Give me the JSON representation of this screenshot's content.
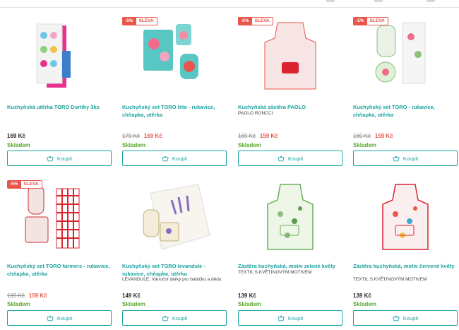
{
  "products": [
    {
      "title": "Kuchyňská utěrka TORO Dortíky 3ks",
      "subtitle": "",
      "badge_pct": "",
      "badge_label": "",
      "price_old": "",
      "price": "169 Kč",
      "stock": "Skladem",
      "buy": "Koupit"
    },
    {
      "title": "Kuchyňský set TORO léto - rukavice, chňapka, utěrka",
      "subtitle": "",
      "badge_pct": "-5%",
      "badge_label": "SLEVA",
      "price_old": "179 Kč",
      "price": "169 Kč",
      "stock": "Skladem",
      "buy": "Koupit"
    },
    {
      "title": "Kuchyňská zástěra PAOLO",
      "subtitle": "PAOLO RONCCI",
      "badge_pct": "-5%",
      "badge_label": "SLEVA",
      "price_old": "169 Kč",
      "price": "159 Kč",
      "stock": "Skladem",
      "buy": "Koupit"
    },
    {
      "title": "Kuchyňský set TORO - rukavice, chňapka, utěrka",
      "subtitle": "",
      "badge_pct": "-5%",
      "badge_label": "SLEVA",
      "price_old": "169 Kč",
      "price": "159 Kč",
      "stock": "Skladem",
      "buy": "Koupit"
    },
    {
      "title": "Kuchyňský set TORO farmers - rukavice, chňapka, utěrka",
      "subtitle": "",
      "badge_pct": "-5%",
      "badge_label": "SLEVA",
      "price_old": "169 Kč",
      "price": "159 Kč",
      "stock": "Skladem",
      "buy": "Koupit"
    },
    {
      "title": "Kuchyňský set TORO levandule - rukavice, chňapka, utěrka",
      "subtitle": "LEVANDULE, Vánoční dárky pro babičku a dědu",
      "badge_pct": "",
      "badge_label": "",
      "price_old": "",
      "price": "149 Kč",
      "stock": "Skladem",
      "buy": "Koupit"
    },
    {
      "title": "Zástěra kuchyňská, motiv zelené květy",
      "subtitle": "TEXTIL S KVĚTINOVÝM MOTIVEM",
      "badge_pct": "",
      "badge_label": "",
      "price_old": "",
      "price": "139 Kč",
      "stock": "Skladem",
      "buy": "Koupit"
    },
    {
      "title": "Zástěra kuchyňská, motiv červené květy",
      "subtitle": "TEXTIL S KVĚTINOVÝM MOTIVEM",
      "badge_pct": "",
      "badge_label": "",
      "price_old": "",
      "price": "139 Kč",
      "stock": "Skladem",
      "buy": "Koupit"
    }
  ],
  "colors": {
    "accent": "#1aa3a0",
    "sale": "#e8564a",
    "stock": "#5aa82d"
  }
}
